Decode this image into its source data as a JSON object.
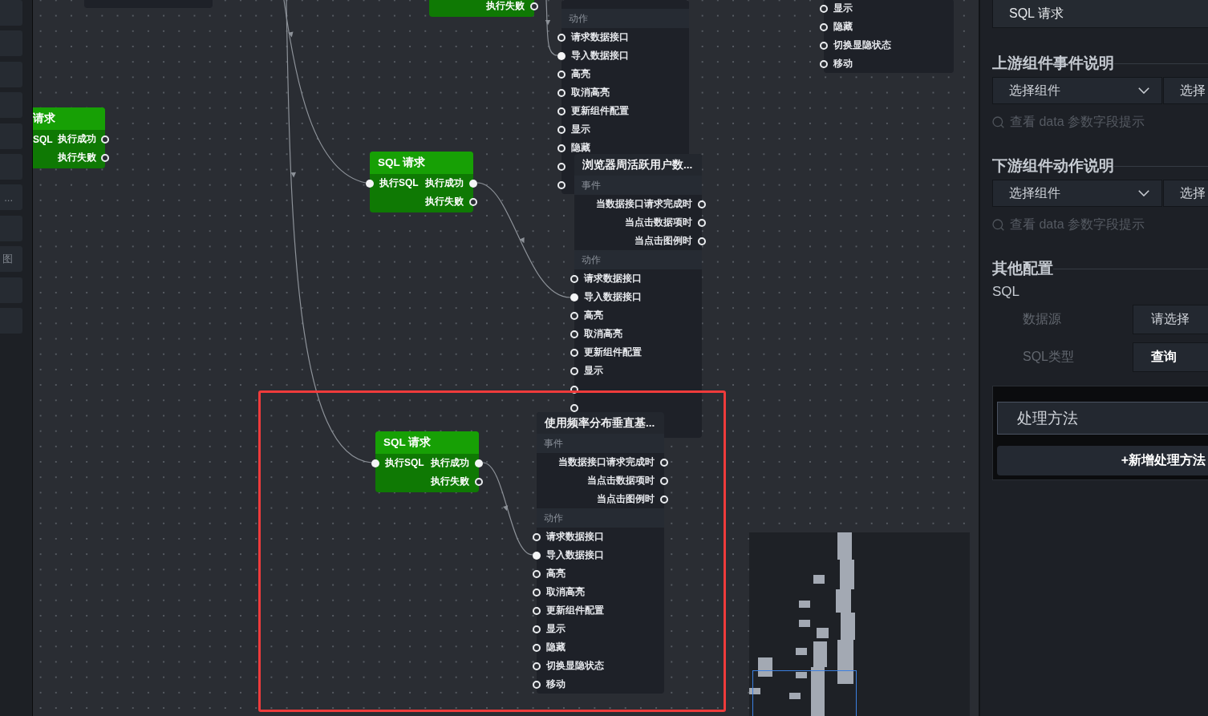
{
  "sidebar": {
    "items": [
      {
        "selected": false
      },
      {
        "selected": false
      },
      {
        "selected": false
      },
      {
        "selected": false
      },
      {
        "selected": false
      },
      {
        "selected": false
      },
      {
        "label": "...",
        "selected": false
      },
      {
        "selected": false
      },
      {
        "label": "图",
        "selected": false
      },
      {
        "selected": false
      },
      {
        "selected": false
      }
    ]
  },
  "canvas": {
    "nodes": [
      {
        "kind": "component"
      },
      {
        "kind": "sql_request",
        "outputs": [
          {
            "label": "执行失败",
            "connected": false
          }
        ]
      },
      {
        "kind": "component",
        "actions": {
          "heading": "动作",
          "items": [
            {
              "label": "请求数据接口",
              "connected": false
            },
            {
              "label": "导入数据接口",
              "connected": true
            },
            {
              "label": "高亮",
              "connected": false
            },
            {
              "label": "取消高亮",
              "connected": false
            },
            {
              "label": "更新组件配置",
              "connected": false
            },
            {
              "label": "显示",
              "connected": false
            },
            {
              "label": "隐藏",
              "connected": false
            },
            {
              "connected": false
            },
            {
              "connected": false
            }
          ]
        }
      },
      {
        "kind": "sql_request",
        "title": "请求",
        "inputs": [
          {
            "label": "SQL"
          }
        ],
        "outputs": [
          {
            "label": "执行成功",
            "connected": false
          },
          {
            "label": "执行失败",
            "connected": false
          }
        ]
      },
      {
        "kind": "sql_request",
        "title": "SQL 请求",
        "inputs": [
          {
            "label": "执行SQL",
            "connected": true
          }
        ],
        "outputs": [
          {
            "label": "执行成功",
            "connected": true
          },
          {
            "label": "执行失败",
            "connected": false
          }
        ]
      },
      {
        "kind": "component",
        "title": "浏览器周活跃用户数...",
        "events": {
          "heading": "事件",
          "items": [
            {
              "label": "当数据接口请求完成时",
              "connected": false
            },
            {
              "label": "当点击数据项时",
              "connected": false
            },
            {
              "label": "当点击图例时",
              "connected": false
            }
          ]
        },
        "actions": {
          "heading": "动作",
          "items": [
            {
              "label": "请求数据接口",
              "connected": false
            },
            {
              "label": "导入数据接口",
              "connected": true
            },
            {
              "label": "高亮",
              "connected": false
            },
            {
              "label": "取消高亮",
              "connected": false
            },
            {
              "label": "更新组件配置",
              "connected": false
            },
            {
              "label": "显示",
              "connected": false
            },
            {
              "connected": false
            },
            {
              "connected": false
            }
          ]
        }
      },
      {
        "kind": "sql_request",
        "title": "SQL 请求",
        "inputs": [
          {
            "label": "执行SQL",
            "connected": true
          }
        ],
        "outputs": [
          {
            "label": "执行成功",
            "connected": true
          },
          {
            "label": "执行失败",
            "connected": false
          }
        ]
      },
      {
        "kind": "component",
        "title": "使用频率分布垂直基...",
        "events": {
          "heading": "事件",
          "items": [
            {
              "label": "当数据接口请求完成时",
              "connected": false
            },
            {
              "label": "当点击数据项时",
              "connected": false
            },
            {
              "label": "当点击图例时",
              "connected": false
            }
          ]
        },
        "actions": {
          "heading": "动作",
          "items": [
            {
              "label": "请求数据接口",
              "connected": false
            },
            {
              "label": "导入数据接口",
              "connected": true
            },
            {
              "label": "高亮",
              "connected": false
            },
            {
              "label": "取消高亮",
              "connected": false
            },
            {
              "label": "更新组件配置",
              "connected": false
            },
            {
              "label": "显示",
              "connected": false
            },
            {
              "label": "隐藏",
              "connected": false
            },
            {
              "label": "切换显隐状态",
              "connected": false
            },
            {
              "label": "移动",
              "connected": false
            }
          ]
        }
      },
      {
        "kind": "component",
        "actions": {
          "items": [
            {
              "label": "显示",
              "connected": false
            },
            {
              "label": "隐藏",
              "connected": false
            },
            {
              "label": "切换显隐状态",
              "connected": false
            },
            {
              "label": "移动",
              "connected": false
            }
          ]
        }
      }
    ]
  },
  "panel": {
    "name_field": {
      "value": "SQL 请求"
    },
    "sections": [
      {
        "kind": "linkage",
        "heading": "上游组件事件说明",
        "selects": [
          {
            "value": "选择组件",
            "caret": true
          },
          {
            "value": "选择"
          }
        ],
        "hint": "查看 data 参数字段提示"
      },
      {
        "kind": "linkage",
        "heading": "下游组件动作说明",
        "selects": [
          {
            "value": "选择组件",
            "caret": true
          },
          {
            "value": "选择"
          }
        ],
        "hint": "查看 data 参数字段提示"
      },
      {
        "kind": "config",
        "heading": "其他配置",
        "subheading": "SQL",
        "fields": [
          {
            "label": "数据源",
            "placeholder": "请选择"
          },
          {
            "label": "SQL类型",
            "value": "查询"
          }
        ]
      }
    ],
    "methods": {
      "header": "处理方法",
      "add_button": "+新增处理方法"
    }
  }
}
